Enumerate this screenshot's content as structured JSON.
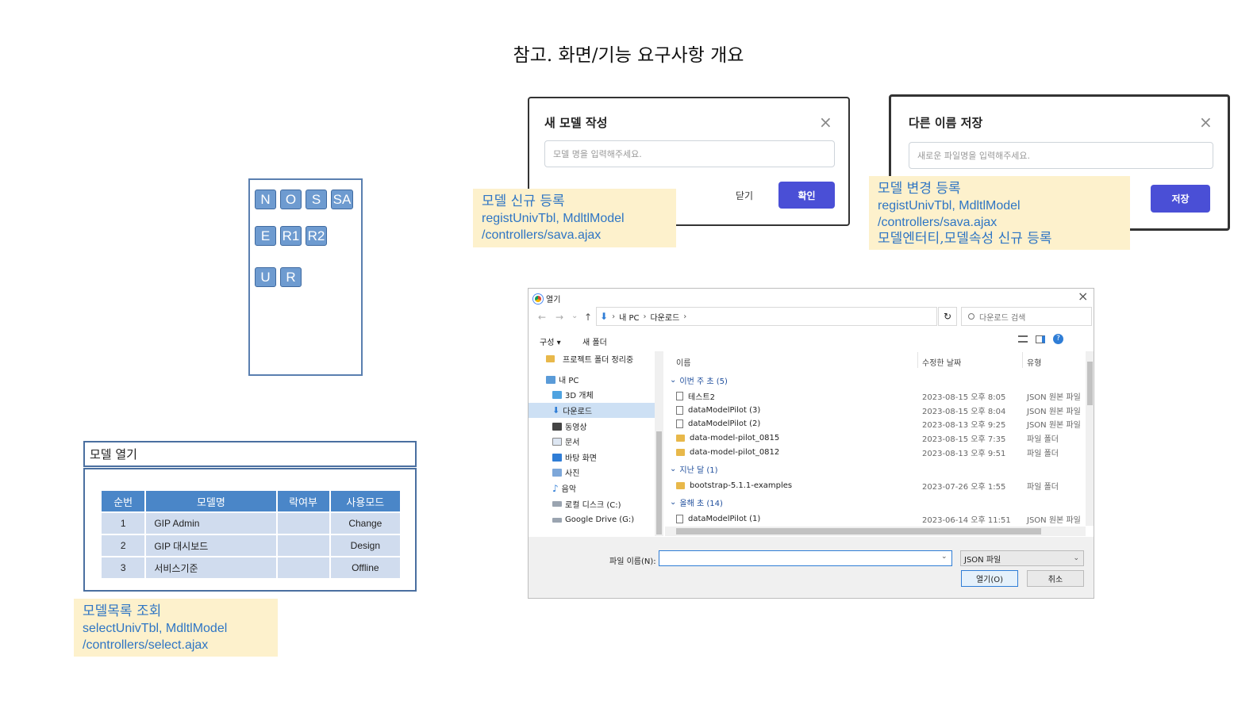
{
  "page": {
    "title": "참고. 화면/기능 요구사항 개요"
  },
  "toolbar": {
    "row1": [
      "N",
      "O",
      "S",
      "SA"
    ],
    "row2": [
      "E",
      "R1",
      "R2"
    ],
    "row3": [
      "U",
      "R"
    ]
  },
  "open_model": {
    "title": "모델 열기",
    "headers": [
      "순번",
      "모델명",
      "락여부",
      "사용모드"
    ],
    "rows": [
      {
        "no": "1",
        "name": "GIP Admin",
        "lock": "",
        "mode": "Change"
      },
      {
        "no": "2",
        "name": "GIP 대시보드",
        "lock": "",
        "mode": "Design"
      },
      {
        "no": "3",
        "name": "서비스기준",
        "lock": "",
        "mode": "Offline"
      }
    ]
  },
  "notes": {
    "list": {
      "title": "모델목록 조회",
      "line1": "selectUnivTbl, MdltlModel",
      "line2": "/controllers/select.ajax"
    },
    "new": {
      "title": "모델 신규 등록",
      "line1": "registUnivTbl, MdltlModel",
      "line2": "/controllers/sava.ajax"
    },
    "change": {
      "title": "모델 변경 등록",
      "line1": "registUnivTbl, MdltlModel",
      "line2": "/controllers/sava.ajax",
      "line3": "모델엔터티,모델속성 신규 등록"
    }
  },
  "new_dialog": {
    "title": "새 모델 작성",
    "close": "×",
    "placeholder": "모델 명을 입력해주세요.",
    "cancel": "닫기",
    "confirm": "확인",
    "accent": "#4a4fd6"
  },
  "saveas_dialog": {
    "title": "다른 이름 저장",
    "close": "×",
    "placeholder": "새로운 파일명을 입력해주세요.",
    "save": "저장"
  },
  "file_dialog": {
    "title": "열기",
    "close": "×",
    "nav": {
      "back": "←",
      "forward": "→",
      "recent": "⌄",
      "up": "↑",
      "down_arrow": "⬇"
    },
    "path": [
      "내 PC",
      "다운로드"
    ],
    "refresh": "↻",
    "search_placeholder": "다운로드 검색",
    "toolbar": {
      "organize": "구성 ▾",
      "new_folder": "새 폴더"
    },
    "sidebar": [
      {
        "label": "프로젝트 폴더 정리중",
        "icon": "folder-icon"
      },
      {
        "label": "내 PC",
        "icon": "pc-icon"
      },
      {
        "label": "3D 개체",
        "icon": "cube-icon"
      },
      {
        "label": "다운로드",
        "icon": "download-icon",
        "selected": true
      },
      {
        "label": "동영상",
        "icon": "video-icon"
      },
      {
        "label": "문서",
        "icon": "document-icon"
      },
      {
        "label": "바탕 화면",
        "icon": "desktop-icon"
      },
      {
        "label": "사진",
        "icon": "picture-icon"
      },
      {
        "label": "음악",
        "icon": "music-icon"
      },
      {
        "label": "로컬 디스크 (C:)",
        "icon": "disk-icon"
      },
      {
        "label": "Google Drive (G:)",
        "icon": "drive-icon"
      }
    ],
    "columns": {
      "name": "이름",
      "date": "수정한 날짜",
      "type": "유형"
    },
    "groups": [
      {
        "label": "이번 주 초 (5)",
        "items": [
          {
            "name": "테스트2",
            "date": "2023-08-15 오후 8:05",
            "type": "JSON 원본 파일",
            "kind": "file"
          },
          {
            "name": "dataModelPilot (3)",
            "date": "2023-08-15 오후 8:04",
            "type": "JSON 원본 파일",
            "kind": "file"
          },
          {
            "name": "dataModelPilot (2)",
            "date": "2023-08-13 오후 9:25",
            "type": "JSON 원본 파일",
            "kind": "file"
          },
          {
            "name": "data-model-pilot_0815",
            "date": "2023-08-15 오후 7:35",
            "type": "파일 폴더",
            "kind": "folder"
          },
          {
            "name": "data-model-pilot_0812",
            "date": "2023-08-13 오후 9:51",
            "type": "파일 폴더",
            "kind": "folder"
          }
        ]
      },
      {
        "label": "지난 달 (1)",
        "items": [
          {
            "name": "bootstrap-5.1.1-examples",
            "date": "2023-07-26 오후 1:55",
            "type": "파일 폴더",
            "kind": "folder"
          }
        ]
      },
      {
        "label": "올해 초 (14)",
        "items": [
          {
            "name": "dataModelPilot (1)",
            "date": "2023-06-14 오후 11:51",
            "type": "JSON 원본 파일",
            "kind": "file"
          }
        ]
      }
    ],
    "filename_label": "파일 이름(N):",
    "filename_value": "",
    "filetype": "JSON 파일",
    "open_button": "열기(O)",
    "cancel_button": "취소"
  }
}
